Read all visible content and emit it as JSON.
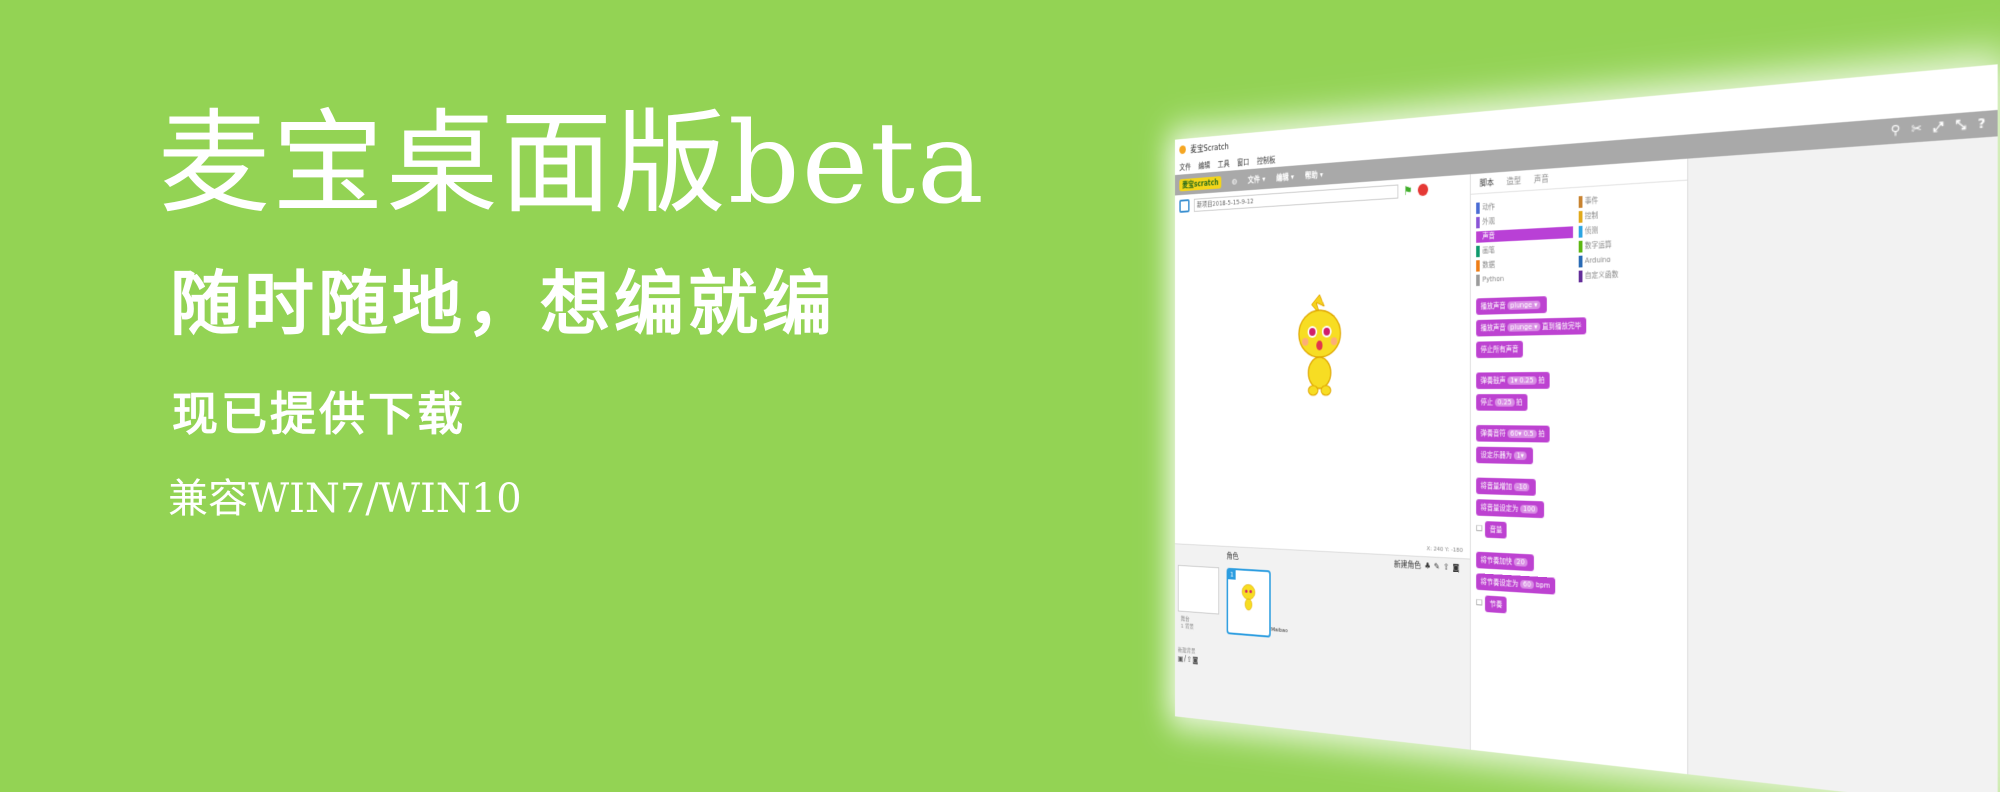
{
  "banner": {
    "headline": "麦宝桌面版beta",
    "tagline": "随时随地，想编就编",
    "download": "现已提供下载",
    "compat": "兼容WIN7/WIN10"
  },
  "app": {
    "window_title": "麦宝Scratch",
    "menu": [
      "文件",
      "编辑",
      "工具",
      "窗口",
      "控制板"
    ],
    "toolbar": {
      "logo": "麦宝scratch",
      "file": "文件 ▾",
      "edit": "编辑 ▾",
      "help": "帮助 ▾"
    },
    "project_name": "新项目2018-5-15-9-12",
    "coords": "X: 240  Y: -180",
    "sprites": {
      "header": "角色",
      "new_sprite": "新建角色",
      "stage_label": "舞台",
      "stage_bg_count": "1 背景",
      "new_bg": "新建背景",
      "sprite_index": "1",
      "sprite_name": "Maibao"
    },
    "tabs": [
      "脚本",
      "造型",
      "声音"
    ],
    "categories_left": [
      "动作",
      "外观",
      "声音",
      "画笔",
      "数据",
      "Python"
    ],
    "categories_right": [
      "事件",
      "控制",
      "侦测",
      "数字运算",
      "Arduino",
      "自定义函数"
    ],
    "blocks": [
      {
        "text": "播放声音",
        "arg": "plunge ▾",
        "tail": ""
      },
      {
        "text": "播放声音",
        "arg": "plunge ▾",
        "tail": "直到播放完毕"
      },
      {
        "text": "停止所有声音",
        "arg": "",
        "tail": ""
      },
      {
        "text": "弹奏鼓声",
        "arg": "1▾ 0.25",
        "tail": "拍"
      },
      {
        "text": "停止",
        "arg": "0.25",
        "tail": "拍"
      },
      {
        "text": "弹奏音符",
        "arg": "60▾ 0.5",
        "tail": "拍"
      },
      {
        "text": "设定乐器为",
        "arg": "1▾",
        "tail": ""
      },
      {
        "text": "将音量增加",
        "arg": "-10",
        "tail": ""
      },
      {
        "text": "将音量设定为",
        "arg": "100",
        "tail": ""
      },
      {
        "text": "音量",
        "arg": "",
        "tail": ""
      },
      {
        "text": "将节奏加快",
        "arg": "20",
        "tail": ""
      },
      {
        "text": "将节奏设定为",
        "arg": "60",
        "tail": "bpm"
      },
      {
        "text": "节奏",
        "arg": "",
        "tail": ""
      }
    ]
  },
  "colors": {
    "background": "#93d354",
    "sound_block": "#bd42d1",
    "toolbar": "#a9a9a9"
  }
}
